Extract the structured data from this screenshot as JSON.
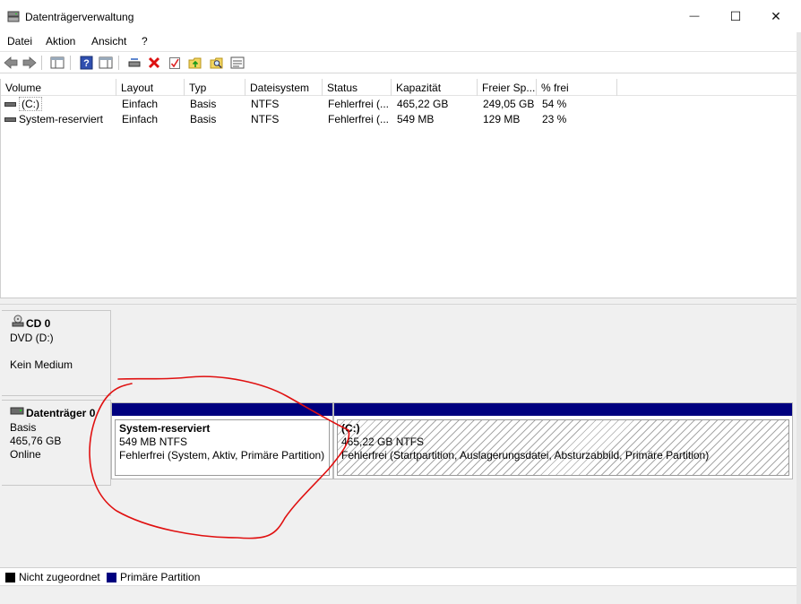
{
  "window": {
    "title": "Datenträgerverwaltung",
    "minimize_glyph": "—",
    "maximize_glyph": "☐",
    "close_glyph": "✕"
  },
  "menu": {
    "items": [
      "Datei",
      "Aktion",
      "Ansicht",
      "?"
    ]
  },
  "toolbar": {
    "icons": [
      "back-arrow-icon",
      "forward-arrow-icon",
      "console-tree-icon",
      "help-icon",
      "properties-panel-icon",
      "connect-drive-icon",
      "delete-icon",
      "check-icon",
      "folder-up-icon",
      "folder-search-icon",
      "list-view-icon"
    ]
  },
  "volumes": {
    "columns": [
      "Volume",
      "Layout",
      "Typ",
      "Dateisystem",
      "Status",
      "Kapazität",
      "Freier Sp...",
      "% frei"
    ],
    "rows": [
      [
        "(C:)",
        "Einfach",
        "Basis",
        "NTFS",
        "Fehlerfrei (...",
        "465,22 GB",
        "249,05 GB",
        "54 %"
      ],
      [
        "System-reserviert",
        "Einfach",
        "Basis",
        "NTFS",
        "Fehlerfrei (...",
        "549 MB",
        "129 MB",
        "23 %"
      ]
    ]
  },
  "disks": {
    "cd0": {
      "title": "CD 0",
      "line1": "DVD (D:)",
      "line2": "Kein Medium"
    },
    "disk0": {
      "title": "Datenträger 0",
      "line1": "Basis",
      "line2": "465,76 GB",
      "line3": "Online"
    },
    "partitions": [
      {
        "name": "System-reserviert",
        "size": "549 MB NTFS",
        "status": "Fehlerfrei (System, Aktiv, Primäre Partition)"
      },
      {
        "name": "(C:)",
        "size": "465,22 GB NTFS",
        "status": "Fehlerfrei (Startpartition, Auslagerungsdatei, Absturzabbild, Primäre Partition)"
      }
    ]
  },
  "legend": {
    "unallocated": "Nicht zugeordnet",
    "primary": "Primäre Partition"
  },
  "colors": {
    "primary_partition": "#00007f",
    "unallocated": "#000000",
    "annotation": "#e01010"
  }
}
